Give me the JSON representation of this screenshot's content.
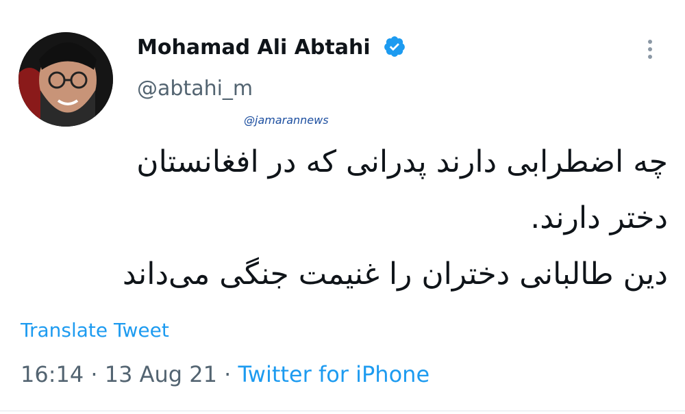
{
  "tweet": {
    "display_name": "Mohamad Ali Abtahi",
    "handle": "@abtahi_m",
    "watermark": "@jamarannews",
    "text_lines": [
      "چه اضطرابی دارند پدرانی که در افغانستان",
      "دختر دارند.",
      "دین طالبانی دختران را غنیمت جنگی می‌داند"
    ],
    "translate_label": "Translate Tweet",
    "time": "16:14",
    "date": "13 Aug 21",
    "separator": "·",
    "source": "Twitter for iPhone"
  },
  "icons": {
    "verified": "verified-badge-icon",
    "more": "more-vertical-icon"
  },
  "colors": {
    "link_blue": "#1d9bf0",
    "secondary_text": "#536471",
    "primary_text": "#0f1419"
  }
}
